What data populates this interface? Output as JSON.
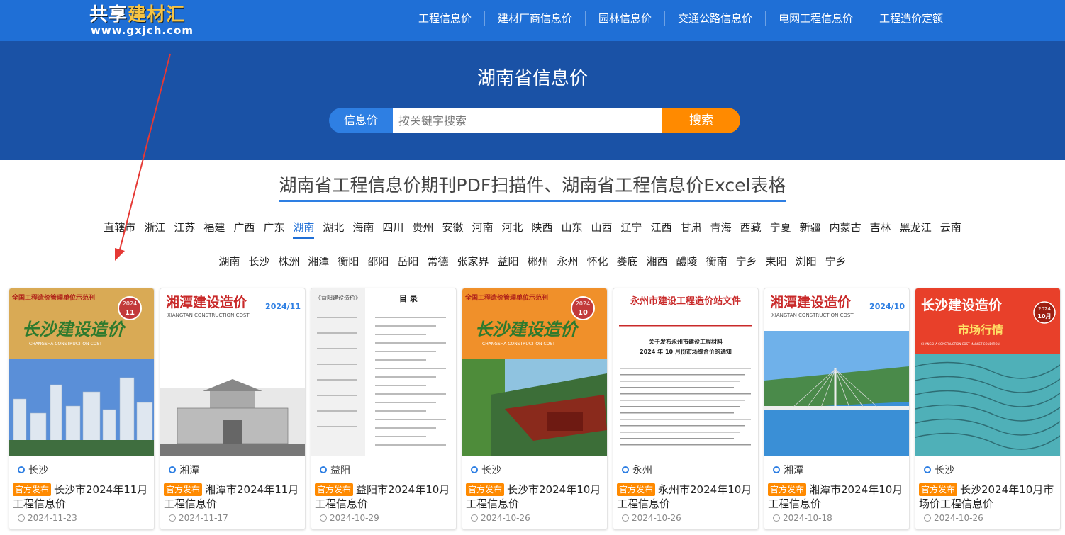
{
  "logo": {
    "line1_a": "共享",
    "line1_b": "建材汇",
    "line2": "www.gxjch.com"
  },
  "nav": {
    "items": [
      {
        "label": "工程信息价"
      },
      {
        "label": "建材厂商信息价"
      },
      {
        "label": "园林信息价"
      },
      {
        "label": "交通公路信息价"
      },
      {
        "label": "电网工程信息价"
      },
      {
        "label": "工程造价定额"
      }
    ]
  },
  "hero": {
    "title": "湖南省信息价",
    "category": "信息价",
    "search_placeholder": "按关键字搜索",
    "search_button": "搜索"
  },
  "section": {
    "title": "湖南省工程信息价期刊PDF扫描件、湖南省工程信息价Excel表格"
  },
  "provinces": {
    "active": "湖南",
    "items": [
      "直辖市",
      "浙江",
      "江苏",
      "福建",
      "广西",
      "广东",
      "湖南",
      "湖北",
      "海南",
      "四川",
      "贵州",
      "安徽",
      "河南",
      "河北",
      "陕西",
      "山东",
      "山西",
      "辽宁",
      "江西",
      "甘肃",
      "青海",
      "西藏",
      "宁夏",
      "新疆",
      "内蒙古",
      "吉林",
      "黑龙江",
      "云南"
    ]
  },
  "cities": {
    "items": [
      "湖南",
      "长沙",
      "株洲",
      "湘潭",
      "衡阳",
      "邵阳",
      "岳阳",
      "常德",
      "张家界",
      "益阳",
      "郴州",
      "永州",
      "怀化",
      "娄底",
      "湘西",
      "醴陵",
      "衡南",
      "宁乡",
      "耒阳",
      "浏阳",
      "宁乡"
    ]
  },
  "badge_label": "官方发布",
  "cards": [
    {
      "city": "长沙",
      "title": "长沙市2024年11月工程信息价",
      "date": "2024-11-23",
      "cover": "cs1"
    },
    {
      "city": "湘潭",
      "title": "湘潭市2024年11月工程信息价",
      "date": "2024-11-17",
      "cover": "xt1"
    },
    {
      "city": "益阳",
      "title": "益阳市2024年10月工程信息价",
      "date": "2024-10-29",
      "cover": "yy"
    },
    {
      "city": "长沙",
      "title": "长沙市2024年10月工程信息价",
      "date": "2024-10-26",
      "cover": "cs2"
    },
    {
      "city": "永州",
      "title": "永州市2024年10月工程信息价",
      "date": "2024-10-26",
      "cover": "yz"
    },
    {
      "city": "湘潭",
      "title": "湘潭市2024年10月工程信息价",
      "date": "2024-10-18",
      "cover": "xt2"
    },
    {
      "city": "长沙",
      "title": "长沙2024年10月市场价工程信息价",
      "date": "2024-10-26",
      "cover": "cs3"
    }
  ],
  "covers": {
    "cs1": {
      "top": "全国工程造价管理单位示范刊",
      "name": "长沙建设造价",
      "en": "CHANGSHA CONSTRUCTION COST",
      "year": "2024",
      "issue": "11"
    },
    "xt1": {
      "name": "湘潭建设造价",
      "en": "XIANGTAN CONSTRUCTION COST",
      "issue": "2024/11"
    },
    "yy": {
      "head": "《益阳建设造价》",
      "toc": "目 录"
    },
    "cs2": {
      "top": "全国工程造价管理单位示范刊",
      "name": "长沙建设造价",
      "en": "CHANGSHA CONSTRUCTION COST",
      "year": "2024",
      "issue": "10"
    },
    "yz": {
      "head": "永州市建设工程造价站文件",
      "notice1": "关于发布永州市建设工程材料",
      "notice2": "2024 年 10 月份市场综合价的通知"
    },
    "xt2": {
      "name": "湘潭建设造价",
      "en": "XIANGTAN CONSTRUCTION COST",
      "issue": "2024/10"
    },
    "cs3": {
      "name": "长沙建设造价",
      "sub": "市场行情",
      "en": "CHANGSHA CONSTRUCTION COST MARKET CONDITION",
      "year": "2024",
      "issue": "10月"
    }
  },
  "colors": {
    "nav": "#1f6fd6",
    "hero": "#1a52a6",
    "accent": "#ff8a00",
    "annotation_arrow": "#e53935"
  }
}
